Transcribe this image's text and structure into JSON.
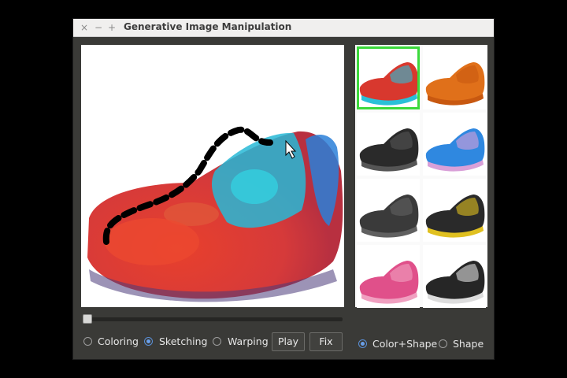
{
  "window": {
    "title": "Generative Image Manipulation",
    "close_glyph": "×",
    "minimize_glyph": "−",
    "maximize_glyph": "+"
  },
  "modes": [
    {
      "label": "Coloring",
      "selected": false
    },
    {
      "label": "Sketching",
      "selected": true
    },
    {
      "label": "Warping",
      "selected": false
    }
  ],
  "buttons": {
    "play": "Play",
    "fix": "Fix"
  },
  "constraints": [
    {
      "label": "Color+Shape",
      "selected": true
    },
    {
      "label": "Shape",
      "selected": false
    }
  ],
  "slider": {
    "value": 0
  },
  "thumbnails": [
    {
      "name": "multicolor-shoe",
      "colors": [
        "#d8382e",
        "#2ac0d8"
      ],
      "selected": true
    },
    {
      "name": "orange-shoe",
      "colors": [
        "#e0701a",
        "#c85810"
      ],
      "selected": false
    },
    {
      "name": "black-shoe",
      "colors": [
        "#2a2a2a",
        "#555555"
      ],
      "selected": false
    },
    {
      "name": "blue-shoe",
      "colors": [
        "#2f88e0",
        "#d9a0d8"
      ],
      "selected": false
    },
    {
      "name": "dark-gray-shoe",
      "colors": [
        "#3a3a3a",
        "#606060"
      ],
      "selected": false
    },
    {
      "name": "black-yellow-sole-shoe",
      "colors": [
        "#2a2a2a",
        "#e0c020"
      ],
      "selected": false
    },
    {
      "name": "pink-shoe",
      "colors": [
        "#e0508a",
        "#f0a0c0"
      ],
      "selected": false
    },
    {
      "name": "black-white-sole-shoe",
      "colors": [
        "#262626",
        "#dddddd"
      ],
      "selected": false
    }
  ]
}
